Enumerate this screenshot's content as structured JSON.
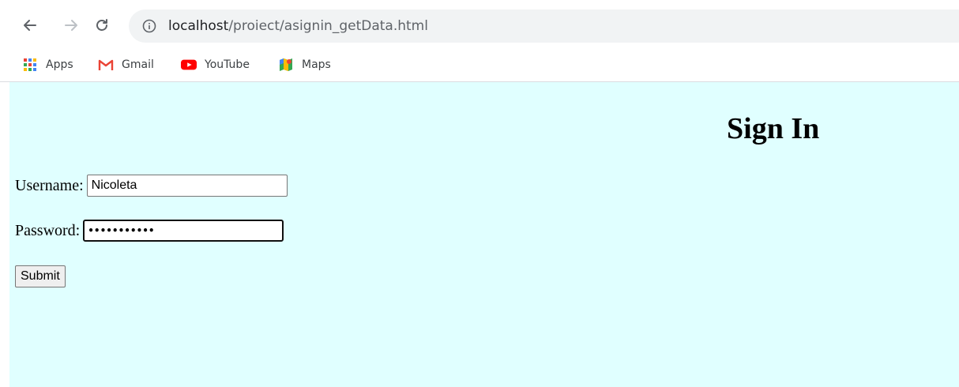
{
  "browser": {
    "url_host": "localhost",
    "url_path": "/proiect/asignin_getData.html",
    "bookmarks": [
      {
        "label": "Apps",
        "icon": "apps-grid-icon"
      },
      {
        "label": "Gmail",
        "icon": "gmail-icon"
      },
      {
        "label": "YouTube",
        "icon": "youtube-icon"
      },
      {
        "label": "Maps",
        "icon": "maps-icon"
      }
    ]
  },
  "page": {
    "background": "#e0ffff",
    "title": "Sign In",
    "form": {
      "username_label": "Username:",
      "username_value": "Nicoleta",
      "password_label": "Password:",
      "password_mask": "•••••••••••",
      "submit_label": "Submit"
    }
  }
}
